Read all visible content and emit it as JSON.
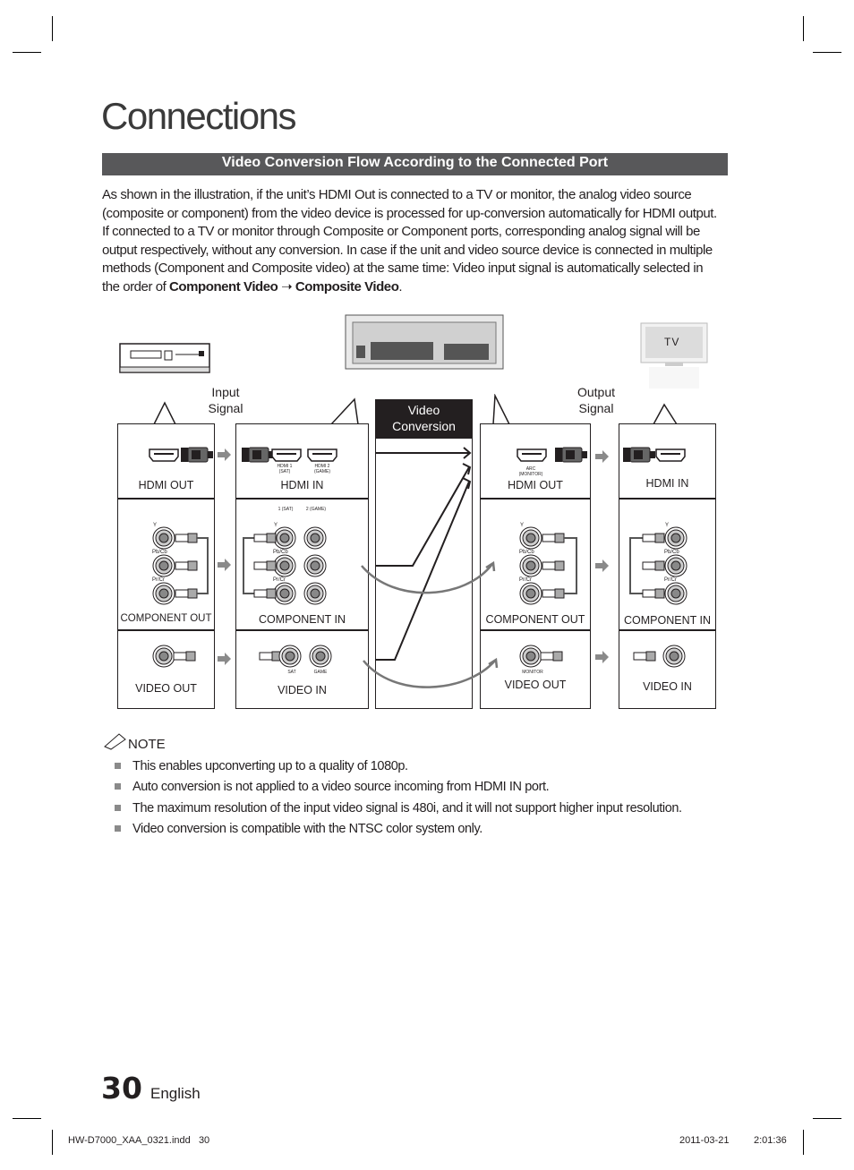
{
  "page_title": "Connections",
  "section_title": "Video Conversion Flow According to the Connected Port",
  "intro": {
    "text_before": "As shown in the illustration, if the unit’s HDMI Out is connected to a TV or monitor, the analog video source (composite or component) from the video device is processed for up-conversion automatically for HDMI output. If connected to a TV or monitor through Composite or Component ports, corresponding analog signal will be output respectively, without any conversion. In case if the unit and video source device is connected in multiple methods (Component and Composite video) at the same time: Video input signal is automatically selected in the order of ",
    "bold1": "Component Video",
    "arrow": " ➝ ",
    "bold2": "Composite Video",
    "text_after": "."
  },
  "diagram": {
    "tv_label": "TV",
    "input_signal": "Input Signal",
    "output_signal": "Output Signal",
    "video_conversion": "Video Conversion",
    "source": {
      "hdmi": "HDMI OUT",
      "component": "COMPONENT OUT",
      "video": "VIDEO OUT"
    },
    "unit_in": {
      "hdmi": "HDMI IN",
      "hdmi1": "HDMI 1 (SAT)",
      "hdmi2": "HDMI 2 (GAME)",
      "comp1": "1 (SAT)",
      "comp2": "2 (GAME)",
      "component": "COMPONENT IN",
      "video": "VIDEO IN",
      "sat": "SAT",
      "game": "GAME"
    },
    "unit_out": {
      "hdmi": "HDMI OUT",
      "arc": "ARC (MONITOR)",
      "component": "COMPONENT OUT",
      "video": "VIDEO OUT",
      "monitor": "MONITOR"
    },
    "tv_in": {
      "hdmi": "HDMI IN",
      "component": "COMPONENT IN",
      "video": "VIDEO IN"
    },
    "jack_labels": {
      "y": "Y",
      "pb": "Pb/Cb",
      "pr": "Pr/Cr"
    }
  },
  "note": {
    "title": "NOTE",
    "items": [
      "This enables upconverting up to a quality of 1080p.",
      "Auto conversion is not applied to a video source incoming from HDMI IN port.",
      "The maximum resolution of the input video signal is 480i, and it will not support higher input resolution.",
      "Video conversion is compatible with the NTSC color system only."
    ]
  },
  "footer": {
    "page_number": "30",
    "language": "English",
    "file": "HW-D7000_XAA_0321.indd   30",
    "date": "2011-03-21",
    "time": "2:01:36"
  },
  "colors": {
    "section_bar": "#58585a",
    "conversion_header": "#231f20",
    "arrow_gray": "#8a8a8a"
  }
}
